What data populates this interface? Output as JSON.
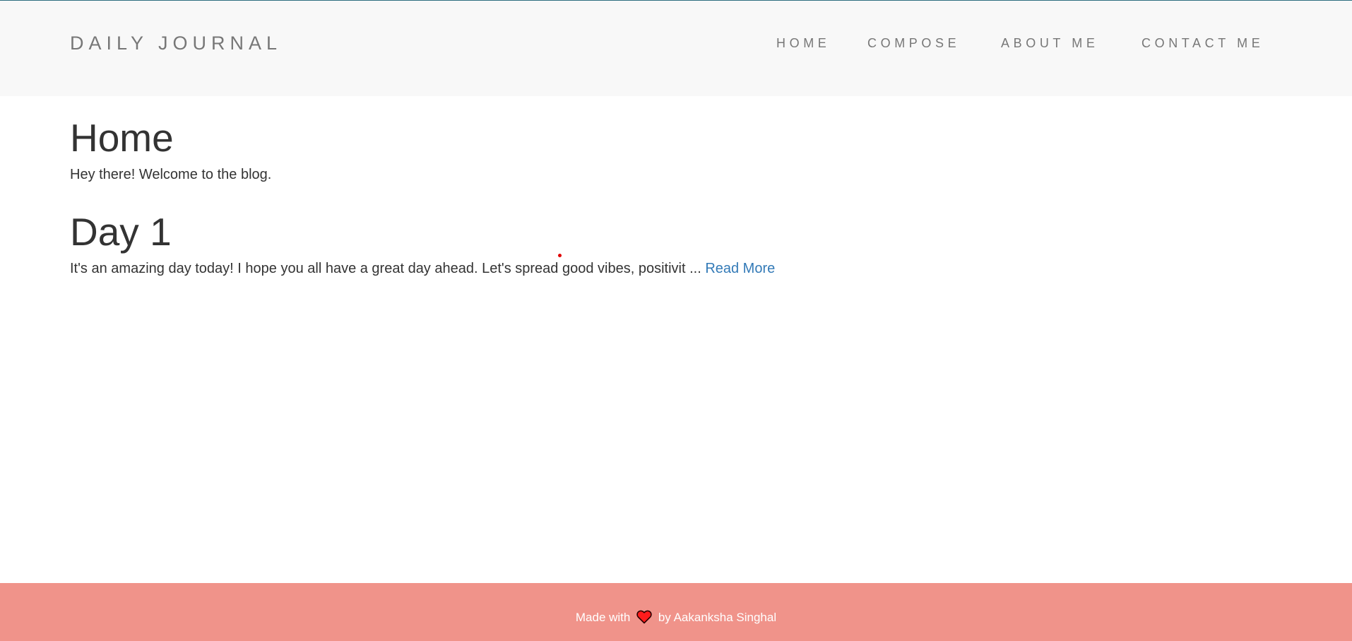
{
  "header": {
    "brand": "DAILY JOURNAL",
    "nav": [
      {
        "label": "HOME"
      },
      {
        "label": "COMPOSE"
      },
      {
        "label": "ABOUT ME"
      },
      {
        "label": "CONTACT ME"
      }
    ]
  },
  "main": {
    "title": "Home",
    "intro": "Hey there! Welcome to the blog.",
    "posts": [
      {
        "title": "Day 1",
        "excerpt": "It's an amazing day today! I hope you all have a great day ahead. Let's spread good vibes, positivit ...",
        "read_more": "Read More"
      }
    ]
  },
  "footer": {
    "prefix": "Made with",
    "icon": "heart-icon",
    "suffix": "by Aakanksha Singhal"
  },
  "colors": {
    "navbar_bg": "#f8f8f8",
    "nav_text": "#777777",
    "link": "#337ab7",
    "footer_bg": "#f0938a",
    "heart": "#ff1c1c"
  }
}
